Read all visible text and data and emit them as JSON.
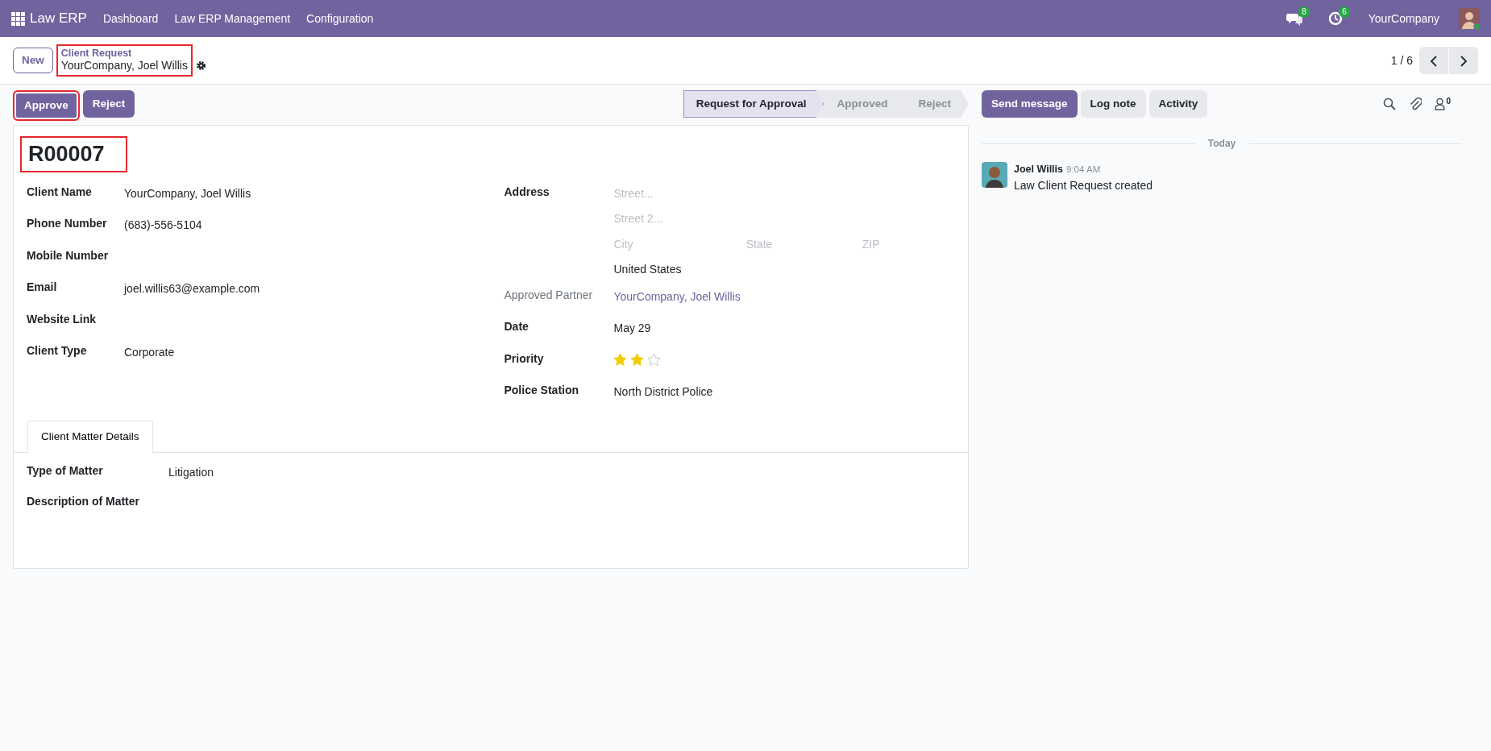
{
  "navbar": {
    "app_name": "Law ERP",
    "menus": [
      "Dashboard",
      "Law ERP Management",
      "Configuration"
    ],
    "messages_count": "8",
    "activities_count": "6",
    "company": "YourCompany"
  },
  "control_panel": {
    "new_button": "New",
    "breadcrumb": "Client Request",
    "record_name": "YourCompany, Joel Willis",
    "highlighted": true,
    "pager": "1 / 6"
  },
  "actions": [
    {
      "label": "Approve",
      "highlighted": true
    },
    {
      "label": "Reject",
      "highlighted": false
    }
  ],
  "stages": [
    {
      "label": "Request for Approval",
      "selected": true
    },
    {
      "label": "Approved",
      "selected": false
    },
    {
      "label": "Reject",
      "selected": false
    }
  ],
  "form": {
    "reference": "R00007",
    "reference_highlighted": true,
    "left_fields": [
      {
        "label": "Client Name",
        "value": "YourCompany, Joel Willis"
      },
      {
        "label": "Phone Number",
        "value": "(683)-556-5104"
      },
      {
        "label": "Mobile Number"
      },
      {
        "label": "Email",
        "value": "joel.willis63@example.com"
      },
      {
        "label": "Website Link"
      },
      {
        "label": "Client Type",
        "value": "Corporate"
      }
    ],
    "address": {
      "label": "Address",
      "street_placeholder": "Street...",
      "street2_placeholder": "Street 2...",
      "city_placeholder": "City",
      "state_placeholder": "State",
      "zip_placeholder": "ZIP",
      "country": "United States"
    },
    "right_fields": [
      {
        "label": "Approved Partner",
        "value": "YourCompany, Joel Willis",
        "kind": "link"
      },
      {
        "label": "Date",
        "value": "May 29",
        "kind": "text"
      },
      {
        "label": "Priority",
        "stars": 2,
        "kind": "stars"
      },
      {
        "label": "Police Station",
        "value": "North District Police",
        "kind": "text"
      }
    ],
    "tabs": [
      {
        "label": "Client Matter Details",
        "selected": true
      }
    ],
    "tab_fields": [
      {
        "label": "Type of Matter",
        "value": "Litigation"
      },
      {
        "label": "Description of Matter"
      }
    ]
  },
  "chatter": {
    "buttons": [
      {
        "label": "Send message",
        "kind": "primary"
      },
      {
        "label": "Log note",
        "kind": "secondary"
      },
      {
        "label": "Activity",
        "kind": "secondary"
      }
    ],
    "followers_count": "0",
    "date_separator": "Today",
    "messages": [
      {
        "author": "Joel Willis",
        "time": "9:04 AM",
        "body": "Law Client Request created"
      }
    ]
  }
}
